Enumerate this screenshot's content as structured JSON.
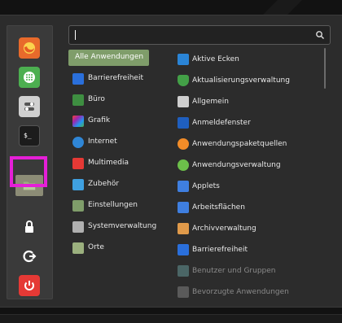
{
  "search": {
    "placeholder": ""
  },
  "favorites": [
    {
      "name": "firefox-icon",
      "color": "#e86a2b"
    },
    {
      "name": "apps-grid-icon",
      "color": "#4caf50"
    },
    {
      "name": "settings-toggle-icon",
      "color": "#d0d0d0"
    },
    {
      "name": "terminal-icon",
      "color": "#2b2b2b"
    },
    {
      "name": "folder-icon",
      "color": "#9bb07e"
    },
    {
      "name": "lock-icon",
      "color": "#2b2b2b"
    },
    {
      "name": "logout-icon",
      "color": "#2b2b2b"
    },
    {
      "name": "power-icon",
      "color": "#e53935"
    }
  ],
  "categories": [
    {
      "label": "Alle Anwendungen",
      "selected": true,
      "icon": "none",
      "color": ""
    },
    {
      "label": "Barrierefreiheit",
      "icon": "accessibility-icon",
      "color": "#2a6fdb"
    },
    {
      "label": "Büro",
      "icon": "office-icon",
      "color": "#3e8e41"
    },
    {
      "label": "Grafik",
      "icon": "graphics-icon",
      "color": "#d63384"
    },
    {
      "label": "Internet",
      "icon": "internet-icon",
      "color": "#2f86d6"
    },
    {
      "label": "Multimedia",
      "icon": "multimedia-icon",
      "color": "#e53935"
    },
    {
      "label": "Zubehör",
      "icon": "accessories-icon",
      "color": "#3fa0e0"
    },
    {
      "label": "Einstellungen",
      "icon": "settings-icon",
      "color": "#7f9d6a"
    },
    {
      "label": "Systemverwaltung",
      "icon": "system-icon",
      "color": "#b0b0b0"
    },
    {
      "label": "Orte",
      "icon": "places-icon",
      "color": "#9bb07e"
    }
  ],
  "apps": [
    {
      "label": "Aktive Ecken",
      "icon": "hot-corners-icon",
      "color": "#2a84d6"
    },
    {
      "label": "Aktualisierungsverwaltung",
      "icon": "update-shield-icon",
      "color": "#43a047"
    },
    {
      "label": "Allgemein",
      "icon": "general-settings-icon",
      "color": "#cfcfcf"
    },
    {
      "label": "Anmeldefenster",
      "icon": "login-window-icon",
      "color": "#1f5fbf"
    },
    {
      "label": "Anwendungspaketquellen",
      "icon": "software-sources-icon",
      "color": "#f28c28"
    },
    {
      "label": "Anwendungsverwaltung",
      "icon": "software-manager-icon",
      "color": "#6cbf4a"
    },
    {
      "label": "Applets",
      "icon": "applets-icon",
      "color": "#3f7fe0"
    },
    {
      "label": "Arbeitsflächen",
      "icon": "workspaces-icon",
      "color": "#3f7fe0"
    },
    {
      "label": "Archivverwaltung",
      "icon": "archive-manager-icon",
      "color": "#e09a4a"
    },
    {
      "label": "Barrierefreiheit",
      "icon": "accessibility-icon",
      "color": "#2a6fdb"
    },
    {
      "label": "Benutzer und Gruppen",
      "icon": "users-groups-icon",
      "color": "#6aa0a0",
      "fade": true
    },
    {
      "label": "Bevorzugte Anwendungen",
      "icon": "preferred-apps-icon",
      "color": "#888",
      "fade": true
    }
  ]
}
